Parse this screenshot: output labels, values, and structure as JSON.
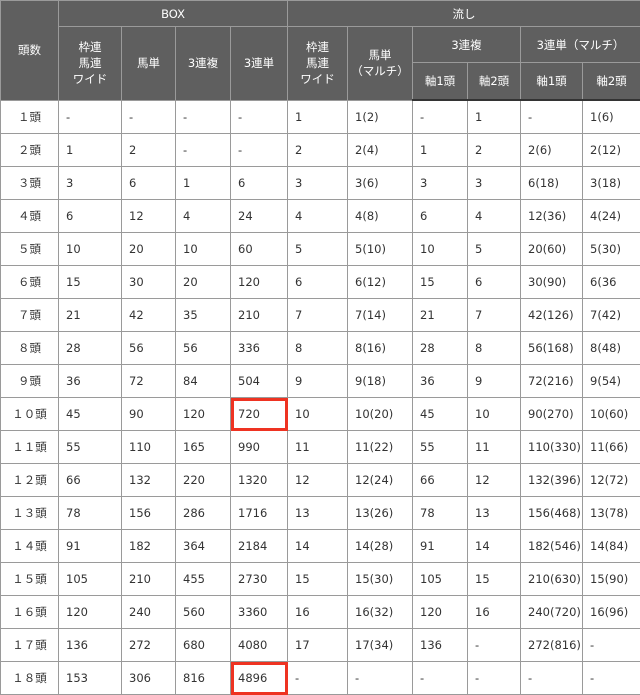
{
  "header": {
    "count_label": "頭数",
    "box_group": "BOX",
    "nagashi_group": "流し",
    "box_cols": [
      "枠連\n馬連\nワイド",
      "馬単",
      "3連複",
      "3連単"
    ],
    "nagashi_cols": {
      "wakuren": "枠連\n馬連\nワイド",
      "umatan": "馬単\n（マルチ）",
      "sanrenpuku": "3連複",
      "sanrentan": "3連単（マルチ）",
      "jiku1": "軸1頭",
      "jiku2": "軸2頭"
    }
  },
  "highlight_color": "#ee3322",
  "rows": [
    {
      "label": "１頭",
      "cells": [
        "-",
        "-",
        "-",
        "-",
        "1",
        "1(2)",
        "-",
        "1",
        "-",
        "1(6)"
      ]
    },
    {
      "label": "２頭",
      "cells": [
        "1",
        "2",
        "-",
        "-",
        "2",
        "2(4)",
        "1",
        "2",
        "2(6)",
        "2(12)"
      ]
    },
    {
      "label": "３頭",
      "cells": [
        "3",
        "6",
        "1",
        "6",
        "3",
        "3(6)",
        "3",
        "3",
        "6(18)",
        "3(18)"
      ]
    },
    {
      "label": "４頭",
      "cells": [
        "6",
        "12",
        "4",
        "24",
        "4",
        "4(8)",
        "6",
        "4",
        "12(36)",
        "4(24)"
      ]
    },
    {
      "label": "５頭",
      "cells": [
        "10",
        "20",
        "10",
        "60",
        "5",
        "5(10)",
        "10",
        "5",
        "20(60)",
        "5(30)"
      ]
    },
    {
      "label": "６頭",
      "cells": [
        "15",
        "30",
        "20",
        "120",
        "6",
        "6(12)",
        "15",
        "6",
        "30(90)",
        "6(36"
      ]
    },
    {
      "label": "７頭",
      "cells": [
        "21",
        "42",
        "35",
        "210",
        "7",
        "7(14)",
        "21",
        "7",
        "42(126)",
        "7(42)"
      ]
    },
    {
      "label": "８頭",
      "cells": [
        "28",
        "56",
        "56",
        "336",
        "8",
        "8(16)",
        "28",
        "8",
        "56(168)",
        "8(48)"
      ]
    },
    {
      "label": "９頭",
      "cells": [
        "36",
        "72",
        "84",
        "504",
        "9",
        "9(18)",
        "36",
        "9",
        "72(216)",
        "9(54)"
      ]
    },
    {
      "label": "１０頭",
      "cells": [
        "45",
        "90",
        "120",
        "720",
        "10",
        "10(20)",
        "45",
        "10",
        "90(270)",
        "10(60)"
      ],
      "highlight": 3
    },
    {
      "label": "１１頭",
      "cells": [
        "55",
        "110",
        "165",
        "990",
        "11",
        "11(22)",
        "55",
        "11",
        "110(330)",
        "11(66)"
      ]
    },
    {
      "label": "１２頭",
      "cells": [
        "66",
        "132",
        "220",
        "1320",
        "12",
        "12(24)",
        "66",
        "12",
        "132(396)",
        "12(72)"
      ]
    },
    {
      "label": "１３頭",
      "cells": [
        "78",
        "156",
        "286",
        "1716",
        "13",
        "13(26)",
        "78",
        "13",
        "156(468)",
        "13(78)"
      ]
    },
    {
      "label": "１４頭",
      "cells": [
        "91",
        "182",
        "364",
        "2184",
        "14",
        "14(28)",
        "91",
        "14",
        "182(546)",
        "14(84)"
      ]
    },
    {
      "label": "１５頭",
      "cells": [
        "105",
        "210",
        "455",
        "2730",
        "15",
        "15(30)",
        "105",
        "15",
        "210(630)",
        "15(90)"
      ]
    },
    {
      "label": "１６頭",
      "cells": [
        "120",
        "240",
        "560",
        "3360",
        "16",
        "16(32)",
        "120",
        "16",
        "240(720)",
        "16(96)"
      ]
    },
    {
      "label": "１７頭",
      "cells": [
        "136",
        "272",
        "680",
        "4080",
        "17",
        "17(34)",
        "136",
        "-",
        "272(816)",
        "-"
      ]
    },
    {
      "label": "１８頭",
      "cells": [
        "153",
        "306",
        "816",
        "4896",
        "-",
        "-",
        "-",
        "-",
        "-",
        "-"
      ],
      "highlight": 3
    }
  ]
}
